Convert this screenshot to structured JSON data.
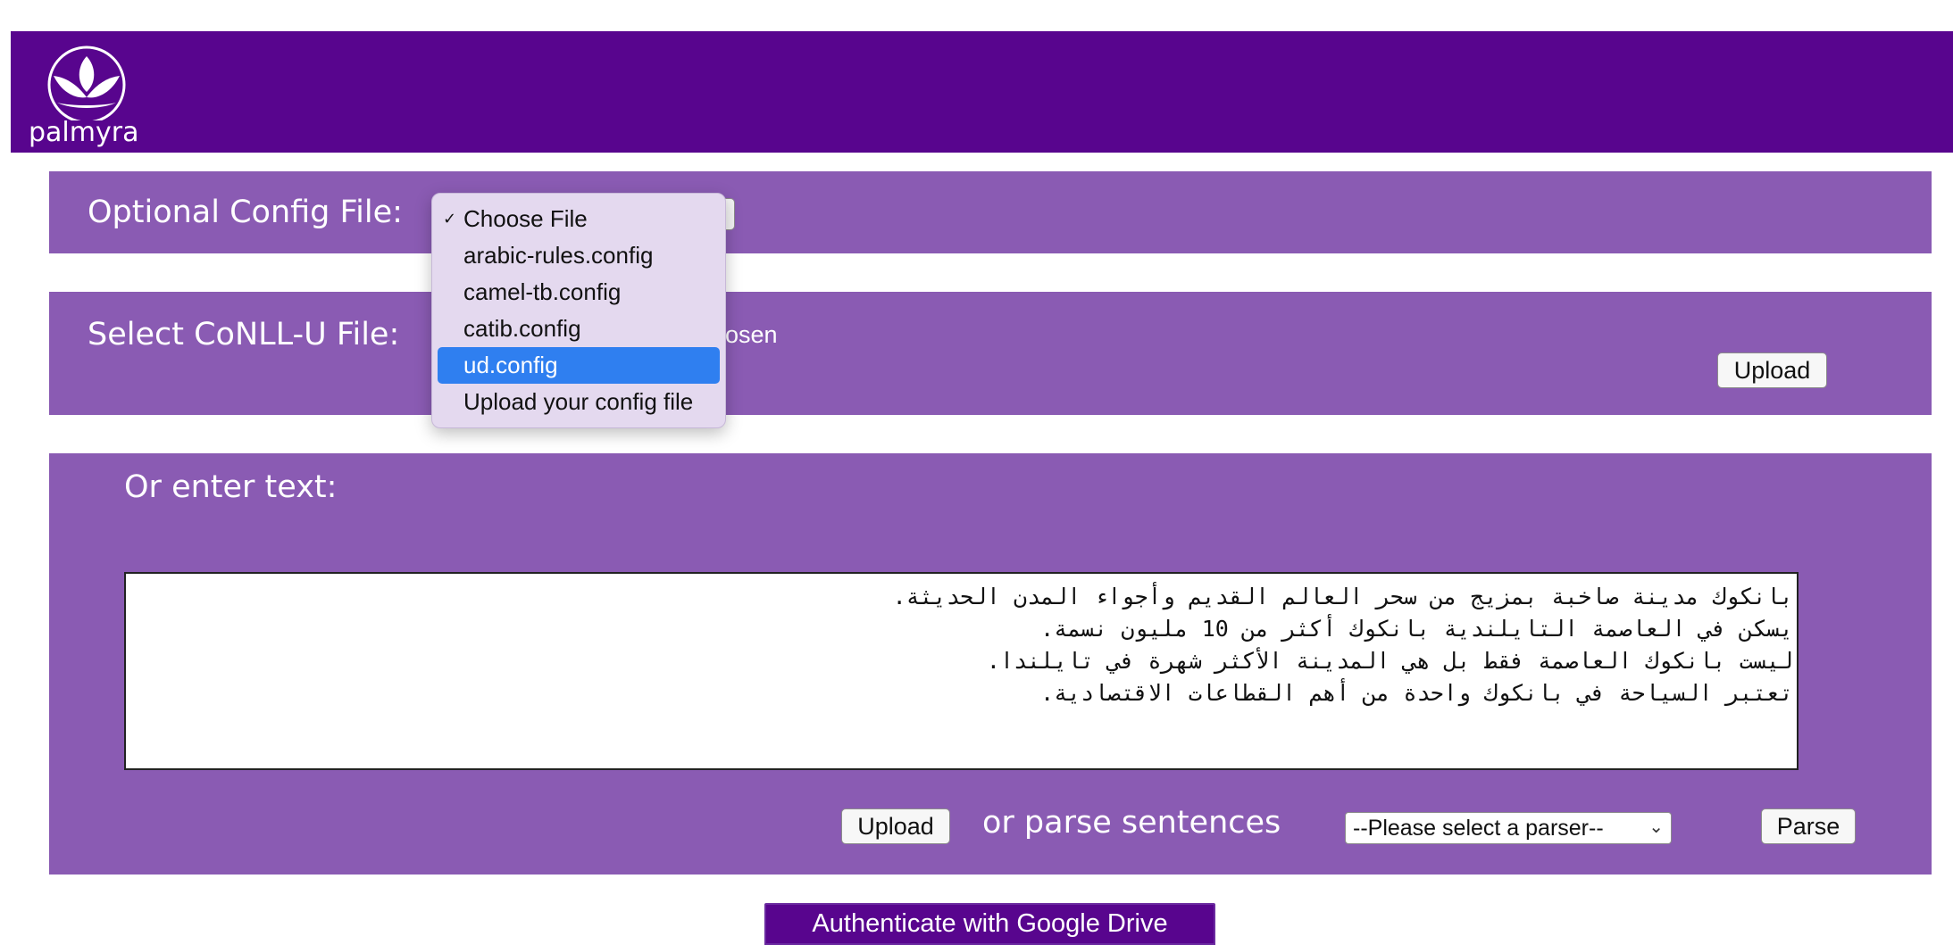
{
  "header": {
    "logo_text": "palmyra",
    "color": "#58058e"
  },
  "config_panel": {
    "label": "Optional Config File:"
  },
  "config_dropdown": {
    "checked_mark": "✓",
    "options": [
      {
        "label": "Choose File",
        "checked": true
      },
      {
        "label": "arabic-rules.config"
      },
      {
        "label": "camel-tb.config"
      },
      {
        "label": "catib.config"
      },
      {
        "label": "ud.config",
        "highlighted": true
      },
      {
        "label": "Upload your config file"
      }
    ]
  },
  "conllu_panel": {
    "label": "Select CoNLL-U File:",
    "no_file_text_visible": "osen",
    "upload_label": "Upload"
  },
  "text_panel": {
    "label": "Or enter text:",
    "text_lines": [
      "بانكوك مدينة صاخبة بمزيج من سحر العالم القديم وأجواء المدن الحديثة.",
      "يسكن في العاصمة التايلندية بانكوك أكثر من 10 مليون نسمة.",
      "ليست بانكوك العاصمة فقط بل هي المدينة الأكثر شهرة في تايلندا.",
      "تعتبر السياحة في بانكوك واحدة من أهم القطاعات الاقتصادية."
    ],
    "upload_label": "Upload",
    "or_parse_text": "or parse sentences",
    "parser_select_value": "--Please select a parser--",
    "parse_label": "Parse"
  },
  "auth": {
    "label": "Authenticate with Google Drive"
  },
  "colors": {
    "panel": "#8a5bb3",
    "highlight": "#2f7ff0"
  }
}
